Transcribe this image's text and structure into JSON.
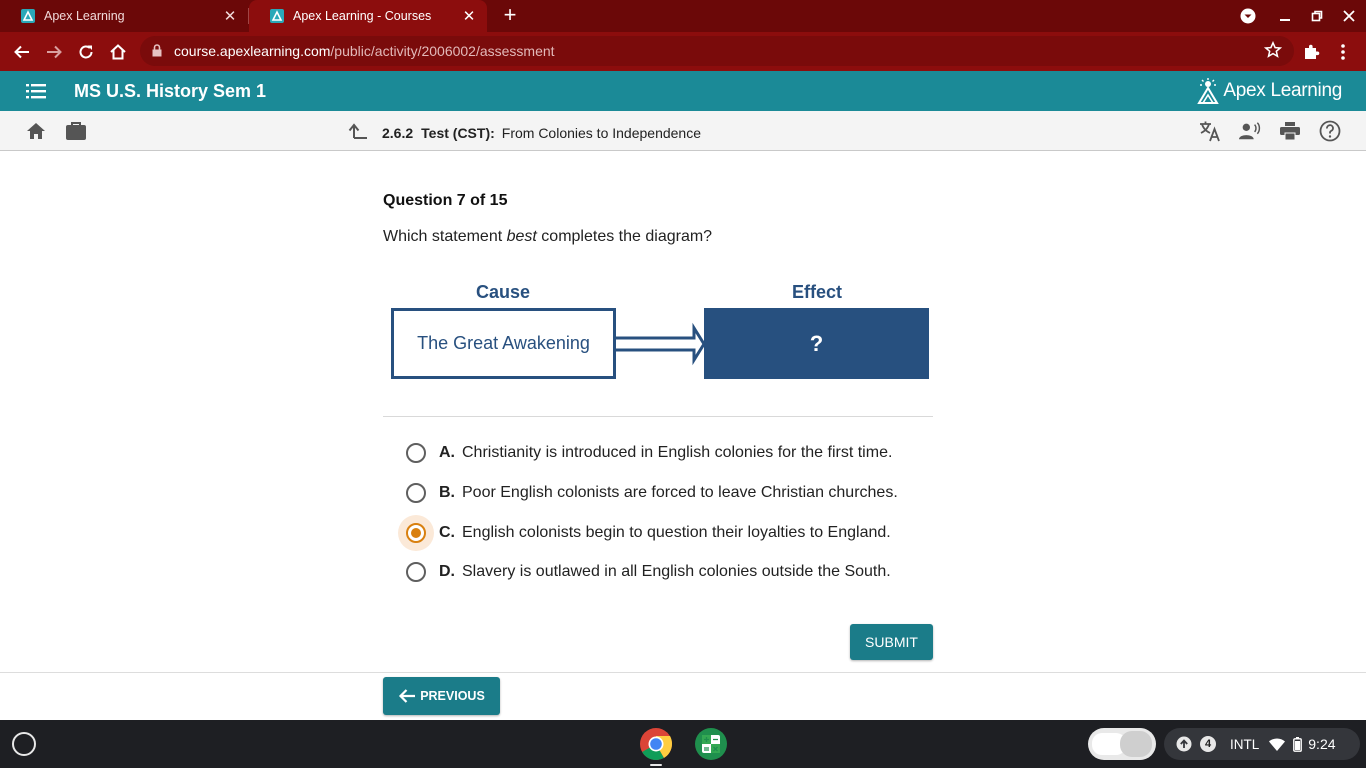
{
  "browser": {
    "tabs": [
      {
        "title": "Apex Learning",
        "active": false
      },
      {
        "title": "Apex Learning - Courses",
        "active": true
      }
    ],
    "url_host": "course.apexlearning.com",
    "url_path": "/public/activity/2006002/assessment",
    "theme_color": "#8c0d0d"
  },
  "header": {
    "course_title": "MS U.S. History Sem 1",
    "logo_text": "Apex Learning",
    "accent_color": "#1b8a97"
  },
  "breadcrumb": {
    "number": "2.6.2",
    "kind": "Test (CST):",
    "name": "From Colonies to Independence"
  },
  "question": {
    "number_label": "Question 7 of 15",
    "prompt_before": "Which statement ",
    "prompt_emphasis": "best",
    "prompt_after": " completes the diagram?"
  },
  "diagram": {
    "cause_heading": "Cause",
    "effect_heading": "Effect",
    "cause_text": "The Great Awakening",
    "effect_text": "?",
    "color": "#27507f"
  },
  "choices": [
    {
      "letter": "A.",
      "text": "Christianity is introduced in English colonies for the first time.",
      "selected": false
    },
    {
      "letter": "B.",
      "text": "Poor English colonists are forced to leave Christian churches.",
      "selected": false
    },
    {
      "letter": "C.",
      "text": "English colonists begin to question their loyalties to England.",
      "selected": true
    },
    {
      "letter": "D.",
      "text": "Slavery is outlawed in all English colonies outside the South.",
      "selected": false
    }
  ],
  "buttons": {
    "submit": "SUBMIT",
    "previous": "PREVIOUS"
  },
  "shelf": {
    "notification_count": "4",
    "input_method": "INTL",
    "time": "9:24"
  },
  "icons": [
    "menu-icon",
    "home-icon",
    "briefcase-icon",
    "up-arrow-icon",
    "translate-icon",
    "text-to-speech-icon",
    "print-icon",
    "help-icon",
    "back-icon",
    "forward-icon",
    "reload-icon",
    "lock-icon",
    "star-icon",
    "extensions-icon",
    "chrome-icon",
    "calculator-icon",
    "wifi-icon",
    "battery-icon"
  ]
}
